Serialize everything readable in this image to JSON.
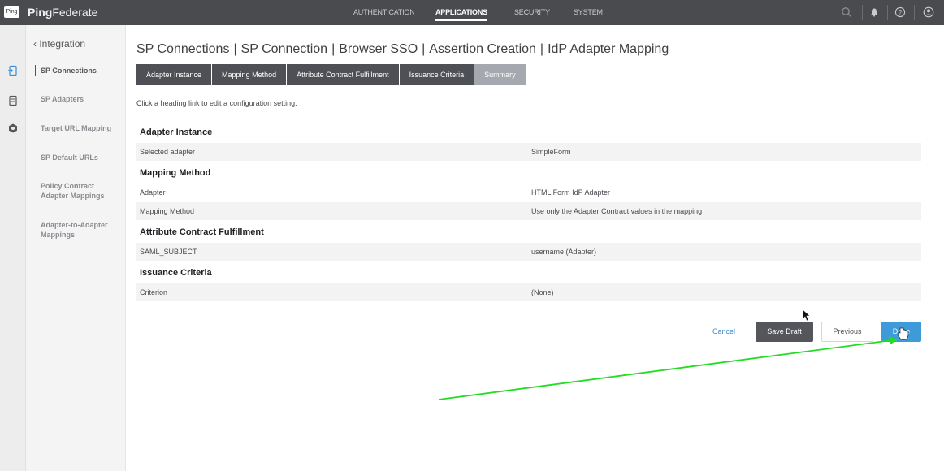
{
  "header": {
    "logo_text": "Ping",
    "brand_bold": "Ping",
    "brand_rest": "Federate",
    "nav": [
      "AUTHENTICATION",
      "APPLICATIONS",
      "SECURITY",
      "SYSTEM"
    ],
    "active_nav": "APPLICATIONS",
    "icons": [
      "search-icon",
      "bell-icon",
      "help-icon",
      "user-icon"
    ]
  },
  "rail": {
    "icons": [
      "sp-connections-icon",
      "sp-adapters-icon",
      "target-url-icon"
    ]
  },
  "sidebar": {
    "back_label": "‹ Integration",
    "items": [
      {
        "label": "SP Connections",
        "active": true
      },
      {
        "label": "SP Adapters"
      },
      {
        "label": "Target URL Mapping"
      },
      {
        "label": "SP Default URLs"
      },
      {
        "label": "Policy Contract Adapter Mappings"
      },
      {
        "label": "Adapter-to-Adapter Mappings"
      }
    ]
  },
  "breadcrumb": [
    "SP Connections",
    "SP Connection",
    "Browser SSO",
    "Assertion Creation",
    "IdP Adapter Mapping"
  ],
  "breadcrumb_separator": "|",
  "tabs": [
    "Adapter Instance",
    "Mapping Method",
    "Attribute Contract Fulfillment",
    "Issuance Criteria",
    "Summary"
  ],
  "current_tab": "Summary",
  "hint": "Click a heading link to edit a configuration setting.",
  "summary": {
    "adapter_instance": {
      "heading": "Adapter Instance",
      "rows": [
        {
          "key": "Selected adapter",
          "value": "SimpleForm"
        }
      ]
    },
    "mapping_method": {
      "heading": "Mapping Method",
      "rows": [
        {
          "key": "Adapter",
          "value": "HTML Form IdP Adapter"
        },
        {
          "key": "Mapping Method",
          "value": "Use only the Adapter Contract values in the mapping"
        }
      ]
    },
    "attribute_contract": {
      "heading": "Attribute Contract Fulfillment",
      "rows": [
        {
          "key": "SAML_SUBJECT",
          "value": "username (Adapter)"
        }
      ]
    },
    "issuance_criteria": {
      "heading": "Issuance Criteria",
      "rows": [
        {
          "key": "Criterion",
          "value": "(None)"
        }
      ]
    }
  },
  "actions": {
    "cancel": "Cancel",
    "save_draft": "Save Draft",
    "previous": "Previous",
    "done": "Done"
  },
  "colors": {
    "topbar": "#4a4b4f",
    "tab": "#4f5055",
    "tab_current": "#a5a8ae",
    "done": "#3e9ad8",
    "annotation_arrow": "#22dd22"
  }
}
